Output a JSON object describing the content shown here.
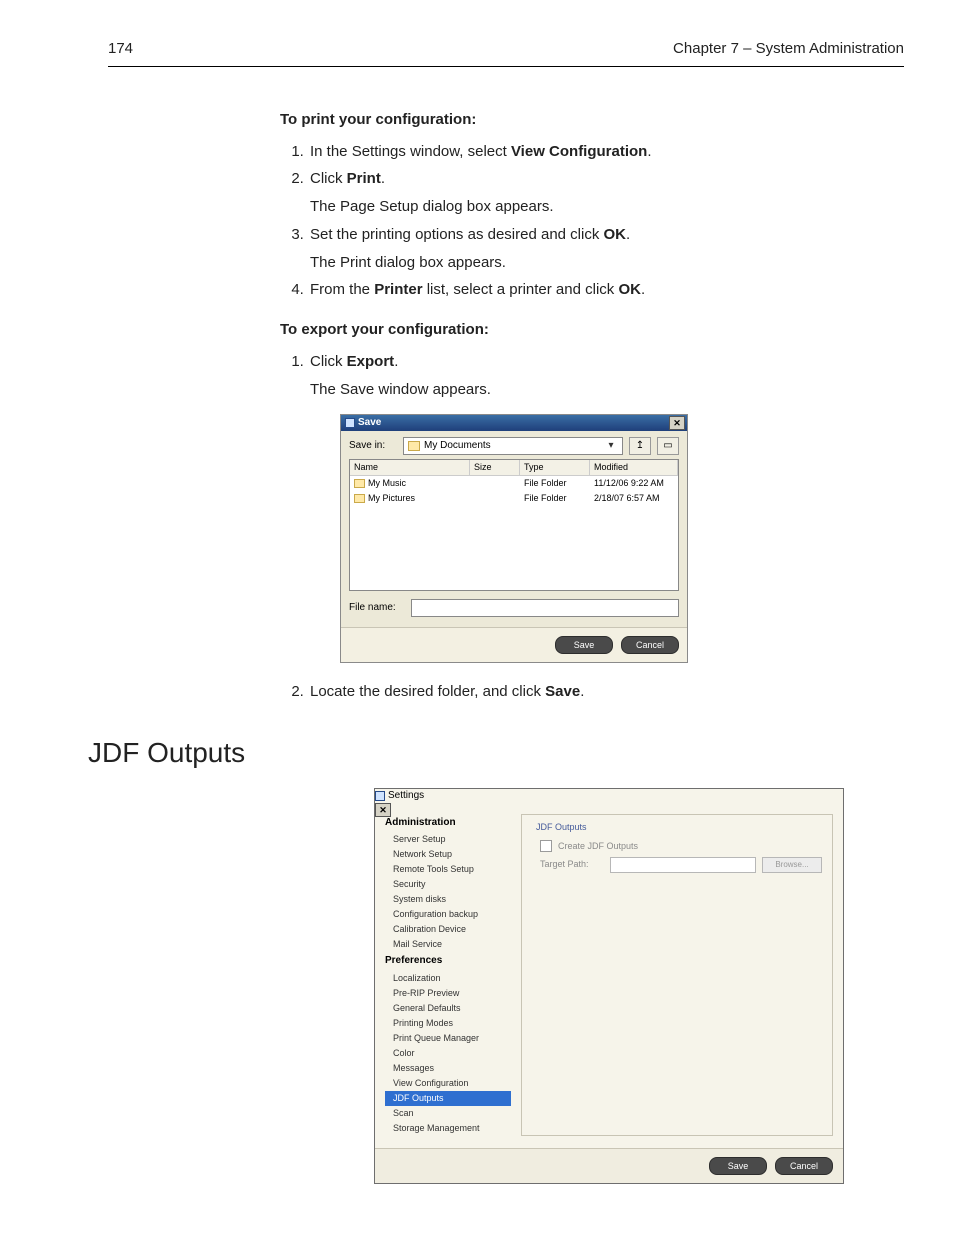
{
  "header": {
    "page_number": "174",
    "chapter": "Chapter 7 – System Administration"
  },
  "sectionA": {
    "heading": "To print your configuration:",
    "items": [
      {
        "pre": "In the Settings window, select ",
        "bold": "View Configuration",
        "post": ".",
        "follow": ""
      },
      {
        "pre": "Click ",
        "bold": "Print",
        "post": ".",
        "follow": "The Page Setup dialog box appears."
      },
      {
        "pre": "Set the printing options as desired and click ",
        "bold": "OK",
        "post": ".",
        "follow": "The Print dialog box appears."
      },
      {
        "pre": "From the ",
        "bold": "Printer",
        "post": " list, select a printer and click ",
        "bold2": "OK",
        "post2": ".",
        "follow": ""
      }
    ]
  },
  "sectionB": {
    "heading": "To export your configuration:",
    "item1": {
      "pre": "Click ",
      "bold": "Export",
      "post": ".",
      "follow": "The Save window appears."
    },
    "item2": {
      "pre": "Locate the desired folder, and click ",
      "bold": "Save",
      "post": "."
    }
  },
  "save_dialog": {
    "title": "Save",
    "save_in_label": "Save in:",
    "save_in_value": "My Documents",
    "columns": {
      "name": "Name",
      "size": "Size",
      "type": "Type",
      "modified": "Modified"
    },
    "rows": [
      {
        "name": "My Music",
        "size": "",
        "type": "File Folder",
        "modified": "11/12/06 9:22 AM"
      },
      {
        "name": "My Pictures",
        "size": "",
        "type": "File Folder",
        "modified": "2/18/07 6:57 AM"
      }
    ],
    "file_name_label": "File name:",
    "file_name_value": "",
    "btn_save": "Save",
    "btn_cancel": "Cancel"
  },
  "section_title": "JDF Outputs",
  "settings_dialog": {
    "title": "Settings",
    "nav": {
      "group_admin": "Administration",
      "admin_items": [
        "Server Setup",
        "Network Setup",
        "Remote Tools Setup",
        "Security",
        "System disks",
        "Configuration backup",
        "Calibration Device",
        "Mail Service"
      ],
      "group_prefs": "Preferences",
      "prefs_items": [
        "Localization",
        "Pre-RIP Preview",
        "General Defaults",
        "Printing Modes",
        "Print Queue Manager",
        "Color",
        "Messages",
        "View Configuration",
        "JDF Outputs",
        "Scan",
        "Storage Management"
      ],
      "selected": "JDF Outputs"
    },
    "panel": {
      "group_label": "JDF Outputs",
      "checkbox_label": "Create JDF Outputs",
      "target_path_label": "Target Path:",
      "target_path_value": "",
      "browse_label": "Browse..."
    },
    "btn_save": "Save",
    "btn_cancel": "Cancel"
  }
}
